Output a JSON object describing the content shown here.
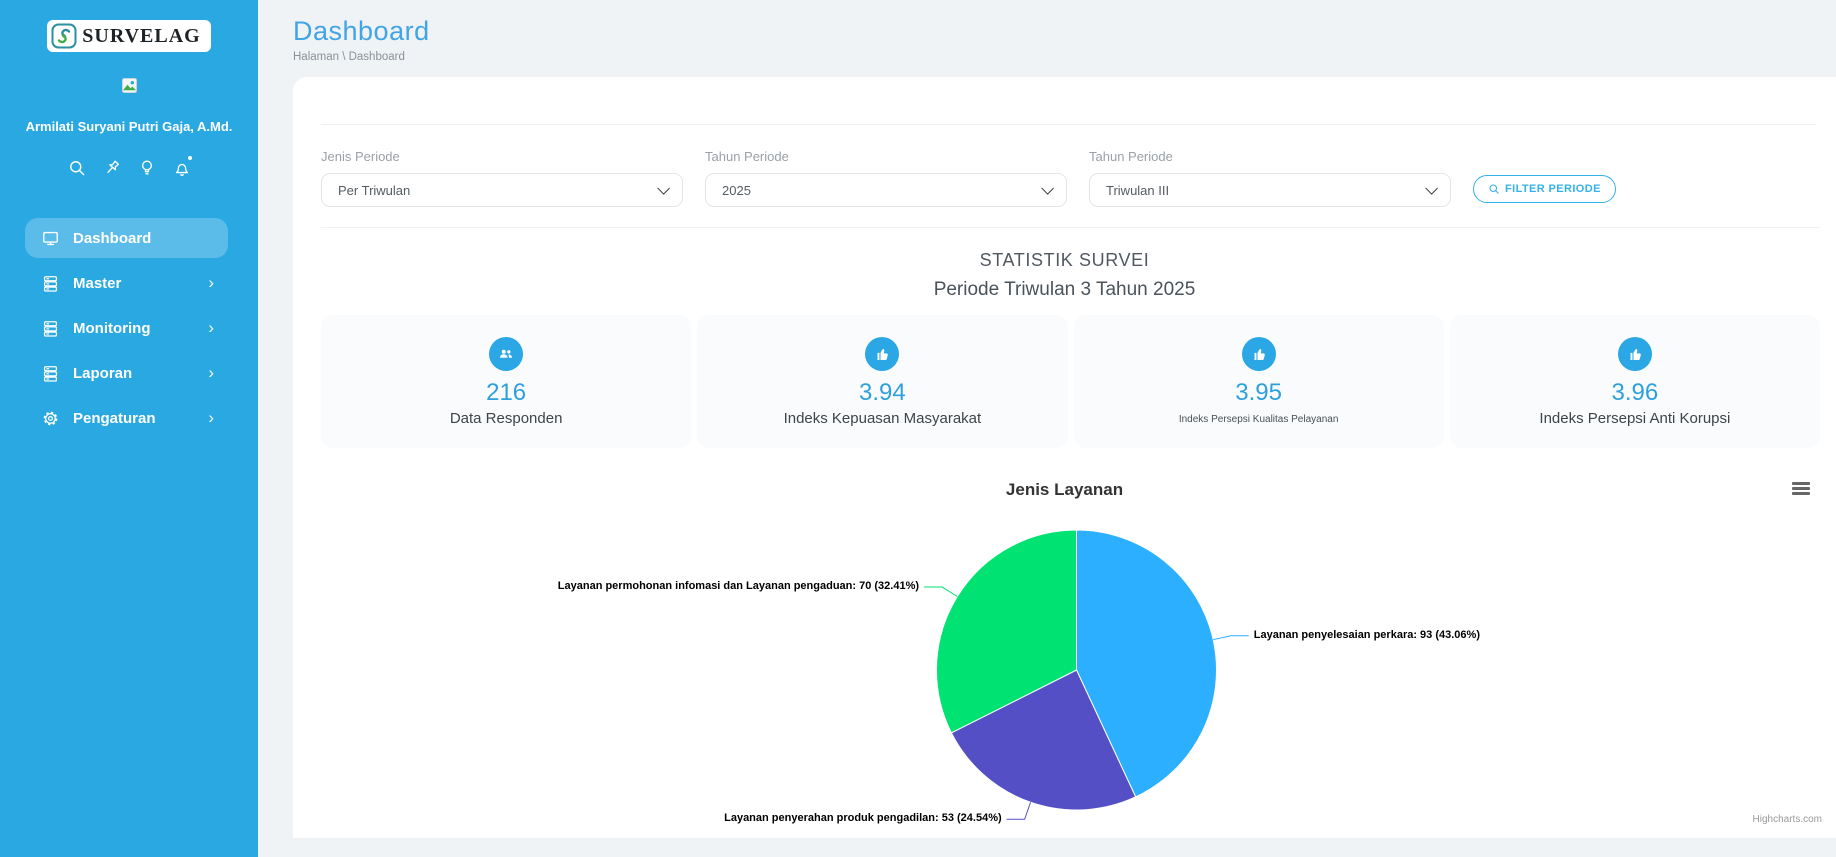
{
  "app": {
    "name": "SURVELAG"
  },
  "sidebar": {
    "user_name": "Armilati Suryani Putri Gaja, A.Md.",
    "quick_icons": [
      "search",
      "pin",
      "lightbulb",
      "bell"
    ],
    "menu": [
      {
        "label": "Dashboard",
        "icon": "monitor",
        "active": true,
        "has_children": false
      },
      {
        "label": "Master",
        "icon": "server",
        "active": false,
        "has_children": true
      },
      {
        "label": "Monitoring",
        "icon": "server",
        "active": false,
        "has_children": true
      },
      {
        "label": "Laporan",
        "icon": "server",
        "active": false,
        "has_children": true
      },
      {
        "label": "Pengaturan",
        "icon": "gear",
        "active": false,
        "has_children": true
      }
    ],
    "chevron": "›"
  },
  "header": {
    "title": "Dashboard",
    "breadcrumb": "Halaman \\ Dashboard"
  },
  "filters": {
    "fields": [
      {
        "label": "Jenis Periode",
        "value": "Per Triwulan"
      },
      {
        "label": "Tahun Periode",
        "value": "2025"
      },
      {
        "label": "Tahun Periode",
        "value": "Triwulan III"
      }
    ],
    "button_label": "FILTER PERIODE"
  },
  "statistics": {
    "title": "STATISTIK SURVEI",
    "subtitle": "Periode Triwulan 3 Tahun 2025",
    "cards": [
      {
        "icon": "users",
        "value": "216",
        "label": "Data Responden"
      },
      {
        "icon": "thumb-up",
        "value": "3.94",
        "label": "Indeks Kepuasan Masyarakat"
      },
      {
        "icon": "thumb-up",
        "value": "3.95",
        "label": "Indeks Persepsi Kualitas Pelayanan"
      },
      {
        "icon": "thumb-up",
        "value": "3.96",
        "label": "Indeks Persepsi Anti Korupsi"
      }
    ]
  },
  "chart_data": {
    "type": "pie",
    "title": "Jenis Layanan",
    "start_angle_deg": 0,
    "direction": "clockwise",
    "legend": "off",
    "credit": "Highcharts.com",
    "series": [
      {
        "name": "Jenis Layanan",
        "data": [
          {
            "name": "Layanan penyelesaian perkara",
            "y": 93,
            "percent": 43.06,
            "color": "#2caffe",
            "label": "Layanan penyelesaian perkara: 93 (43.06%)"
          },
          {
            "name": "Layanan penyerahan produk pengadilan",
            "y": 53,
            "percent": 24.54,
            "color": "#544fc5",
            "label": "Layanan penyerahan produk pengadilan: 53 (24.54%)"
          },
          {
            "name": "Layanan permohonan infomasi dan Layanan pengaduan",
            "y": 70,
            "percent": 32.41,
            "color": "#00e272",
            "label": "Layanan permohonan infomasi dan Layanan pengaduan: 70 (32.41%)"
          }
        ]
      }
    ]
  },
  "colors": {
    "sidebar": "#2aa8e2",
    "accent_blue": "#2da0dd",
    "title_blue": "#41a4e6",
    "button_outline": "#35b2ea",
    "pie": [
      "#2caffe",
      "#544fc5",
      "#00e272"
    ]
  }
}
